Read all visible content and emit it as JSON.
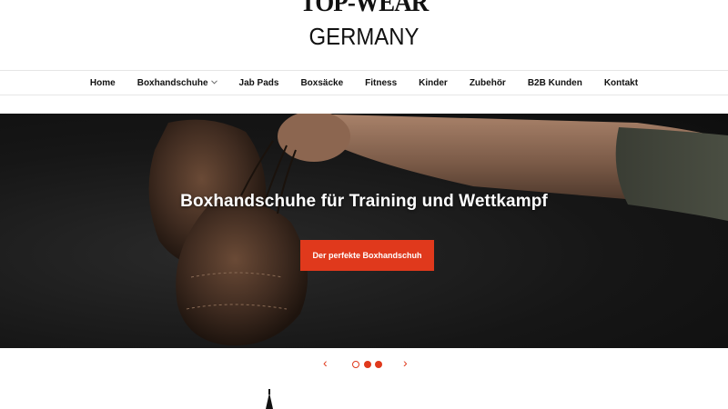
{
  "logo": {
    "top_text": "TOP-WEAR",
    "bottom_text": "GERMANY"
  },
  "nav": {
    "items": [
      {
        "label": "Home",
        "dropdown": false
      },
      {
        "label": "Boxhandschuhe",
        "dropdown": true
      },
      {
        "label": "Jab Pads",
        "dropdown": false
      },
      {
        "label": "Boxsäcke",
        "dropdown": false
      },
      {
        "label": "Fitness",
        "dropdown": false
      },
      {
        "label": "Kinder",
        "dropdown": false
      },
      {
        "label": "Zubehör",
        "dropdown": false
      },
      {
        "label": "B2B Kunden",
        "dropdown": false
      },
      {
        "label": "Kontakt",
        "dropdown": false
      }
    ],
    "dropdown_icon": "chevron-down-icon"
  },
  "hero": {
    "title": "Boxhandschuhe für Training und Wettkampf",
    "button_label": "Der perfekte Boxhandschuh"
  },
  "slider": {
    "prev_icon": "chevron-left-icon",
    "next_icon": "chevron-right-icon",
    "prev_glyph": "‹",
    "next_glyph": "›",
    "slide_count": 3,
    "active_index": 0
  },
  "colors": {
    "accent": "#e0391c",
    "nav_text": "#111111",
    "hero_bg": "#161616"
  }
}
